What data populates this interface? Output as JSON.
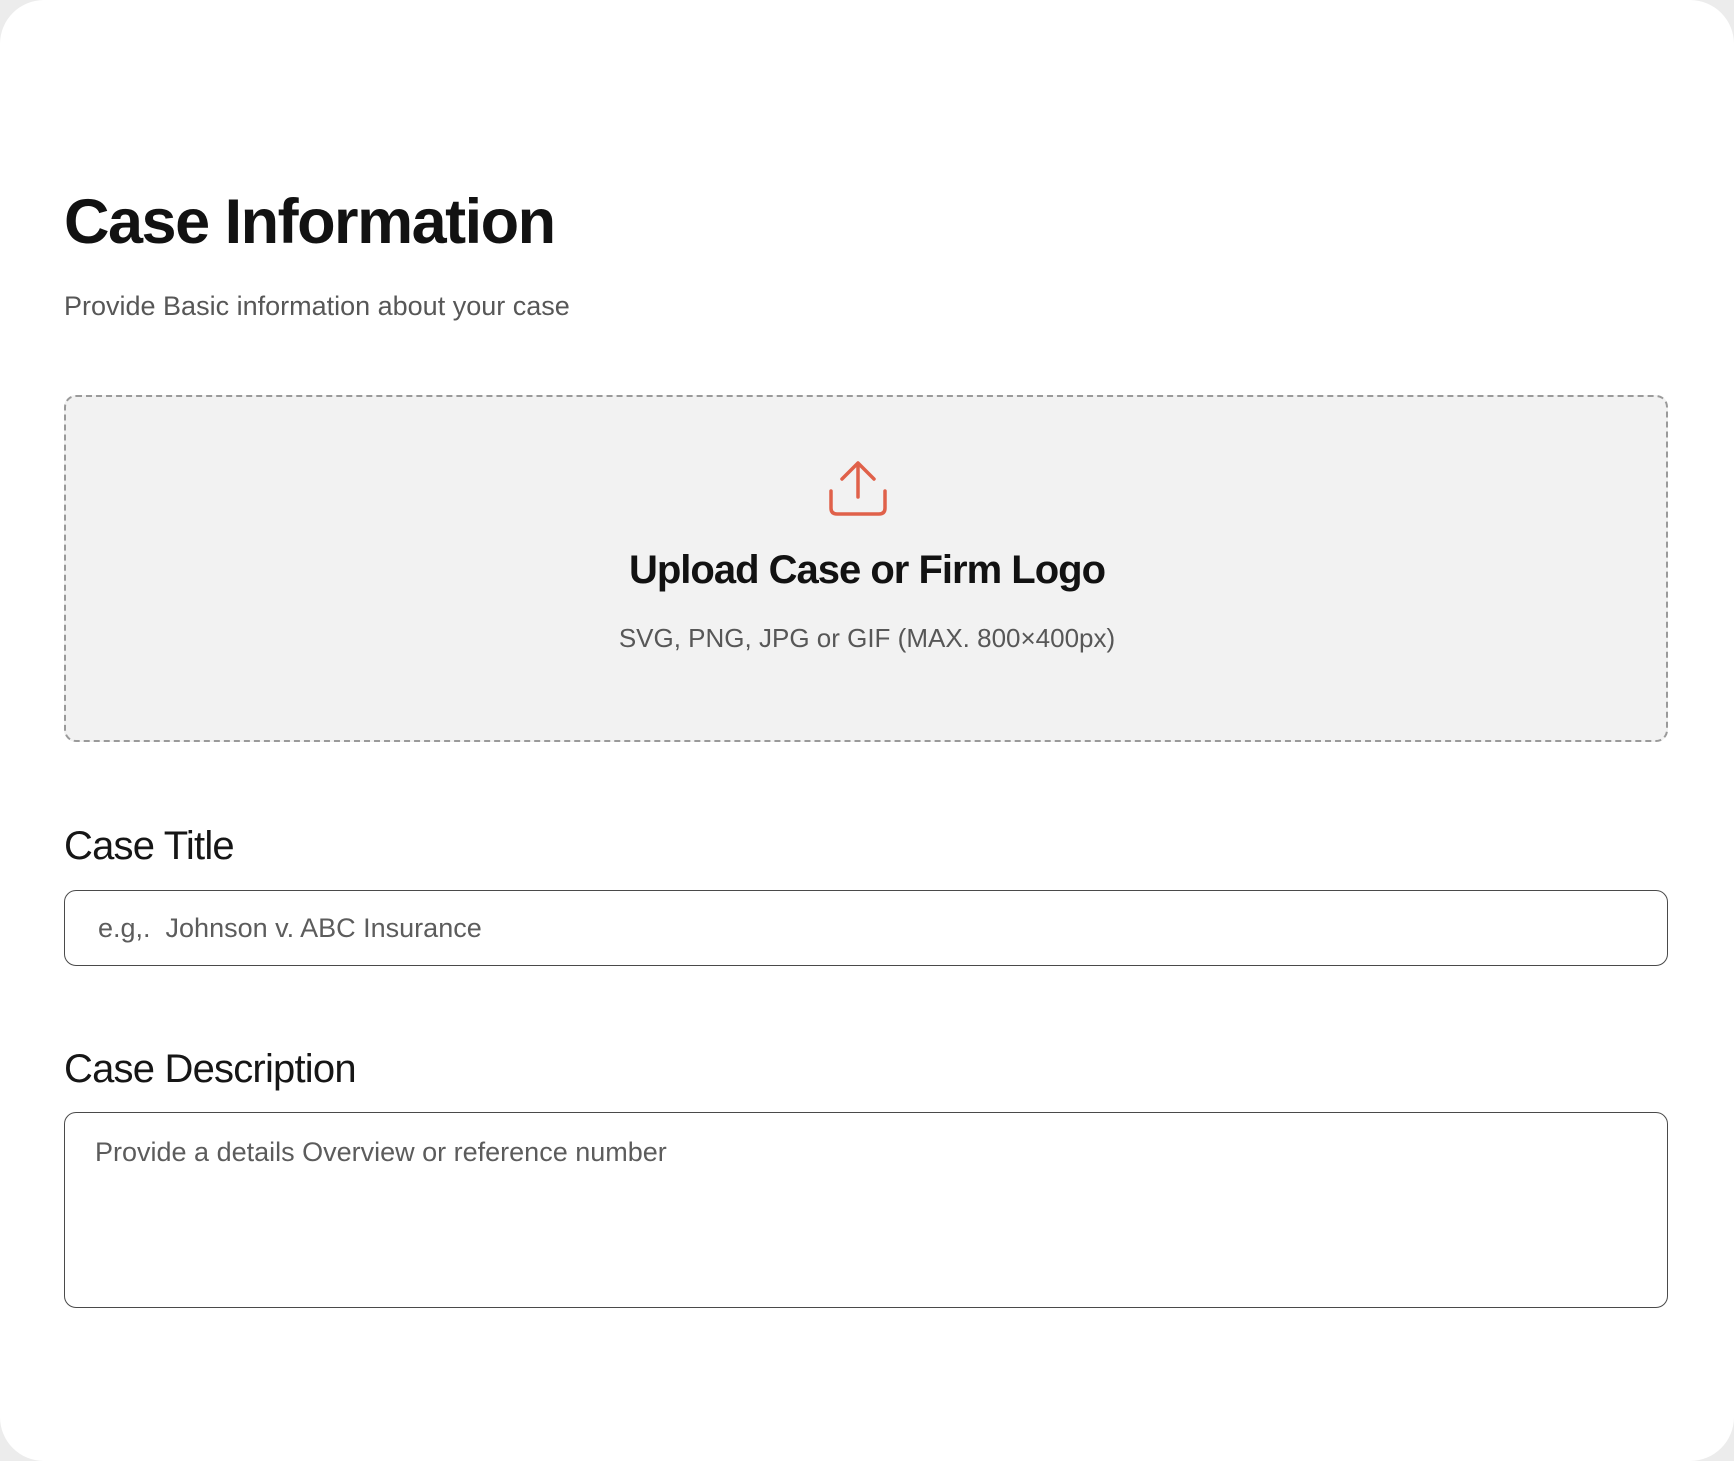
{
  "header": {
    "title": "Case Information",
    "subtitle": "Provide Basic information about your case"
  },
  "upload": {
    "icon": "upload-icon",
    "icon_color": "#e0614a",
    "title": "Upload Case or Firm Logo",
    "hint": "SVG, PNG, JPG or GIF (MAX. 800×400px)"
  },
  "case_title": {
    "label": "Case Title",
    "value": "",
    "placeholder": "e.g,.  Johnson v. ABC Insurance"
  },
  "case_description": {
    "label": "Case Description",
    "value": "",
    "placeholder": "Provide a details Overview or reference number"
  }
}
